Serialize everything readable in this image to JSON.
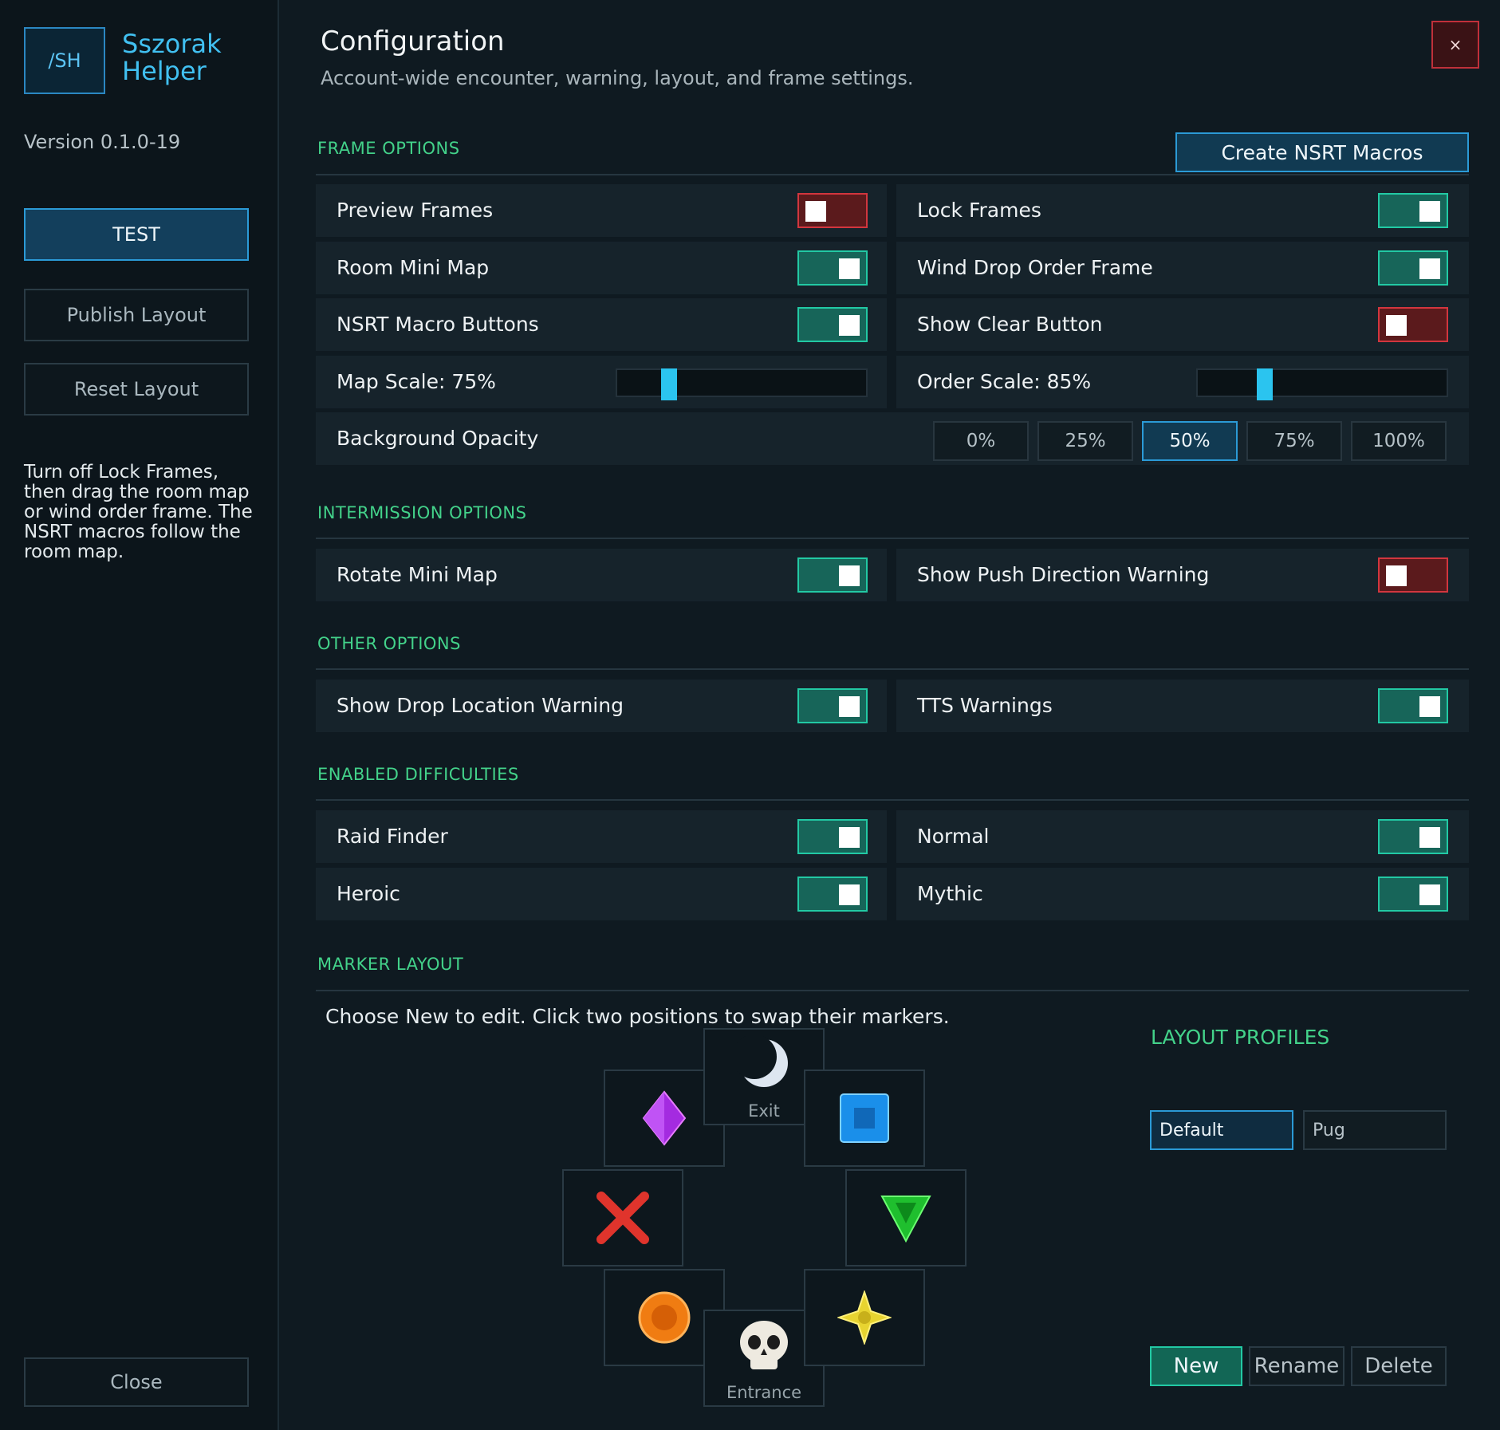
{
  "sidebar": {
    "logo_text": "/SH",
    "app_title": "Sszorak Helper",
    "version": "Version 0.1.0-19",
    "test_label": "TEST",
    "publish_label": "Publish Layout",
    "reset_label": "Reset Layout",
    "help_text": "Turn off Lock Frames, then drag the room map or wind order frame. The NSRT macros follow the room map.",
    "close_label": "Close"
  },
  "header": {
    "title": "Configuration",
    "subtitle": "Account-wide encounter, warning, layout, and frame settings.",
    "close_glyph": "×"
  },
  "colors": {
    "accent_blue": "#2b9ad6",
    "section_green": "#43d28a",
    "toggle_on": "#176559",
    "toggle_off": "#5b1a1c"
  },
  "frame_options": {
    "label": "FRAME OPTIONS",
    "macro_button": "Create NSRT Macros",
    "preview_frames": {
      "label": "Preview Frames",
      "on": false
    },
    "lock_frames": {
      "label": "Lock Frames",
      "on": true
    },
    "room_mini_map": {
      "label": "Room Mini Map",
      "on": true
    },
    "wind_drop_order": {
      "label": "Wind Drop Order Frame",
      "on": true
    },
    "nsrt_macro_buttons": {
      "label": "NSRT Macro Buttons",
      "on": true
    },
    "show_clear_button": {
      "label": "Show Clear Button",
      "on": false
    },
    "map_scale": {
      "label": "Map Scale: 75%",
      "value_fraction": 0.18
    },
    "order_scale": {
      "label": "Order Scale: 85%",
      "value_fraction": 0.24
    },
    "bg_opacity": {
      "label": "Background Opacity",
      "options": [
        "0%",
        "25%",
        "50%",
        "75%",
        "100%"
      ],
      "selected": "50%"
    }
  },
  "intermission_options": {
    "label": "INTERMISSION OPTIONS",
    "rotate_mini_map": {
      "label": "Rotate Mini Map",
      "on": true
    },
    "push_direction_warning": {
      "label": "Show Push Direction Warning",
      "on": false
    }
  },
  "other_options": {
    "label": "OTHER OPTIONS",
    "drop_location_warning": {
      "label": "Show Drop Location Warning",
      "on": true
    },
    "tts_warnings": {
      "label": "TTS Warnings",
      "on": true
    }
  },
  "difficulties": {
    "label": "ENABLED DIFFICULTIES",
    "raid_finder": {
      "label": "Raid Finder",
      "on": true
    },
    "normal": {
      "label": "Normal",
      "on": true
    },
    "heroic": {
      "label": "Heroic",
      "on": true
    },
    "mythic": {
      "label": "Mythic",
      "on": true
    }
  },
  "marker_layout": {
    "label": "MARKER LAYOUT",
    "hint": "Choose New to edit. Click two positions to swap their markers.",
    "exit_label": "Exit",
    "entrance_label": "Entrance",
    "markers": [
      "moon-icon",
      "diamond-icon",
      "square-icon",
      "cross-icon",
      "triangle-icon",
      "circle-icon",
      "skull-icon",
      "star-icon"
    ]
  },
  "profiles": {
    "label": "LAYOUT PROFILES",
    "items": [
      "Default",
      "Pug"
    ],
    "selected": "Default",
    "new_label": "New",
    "rename_label": "Rename",
    "delete_label": "Delete"
  }
}
